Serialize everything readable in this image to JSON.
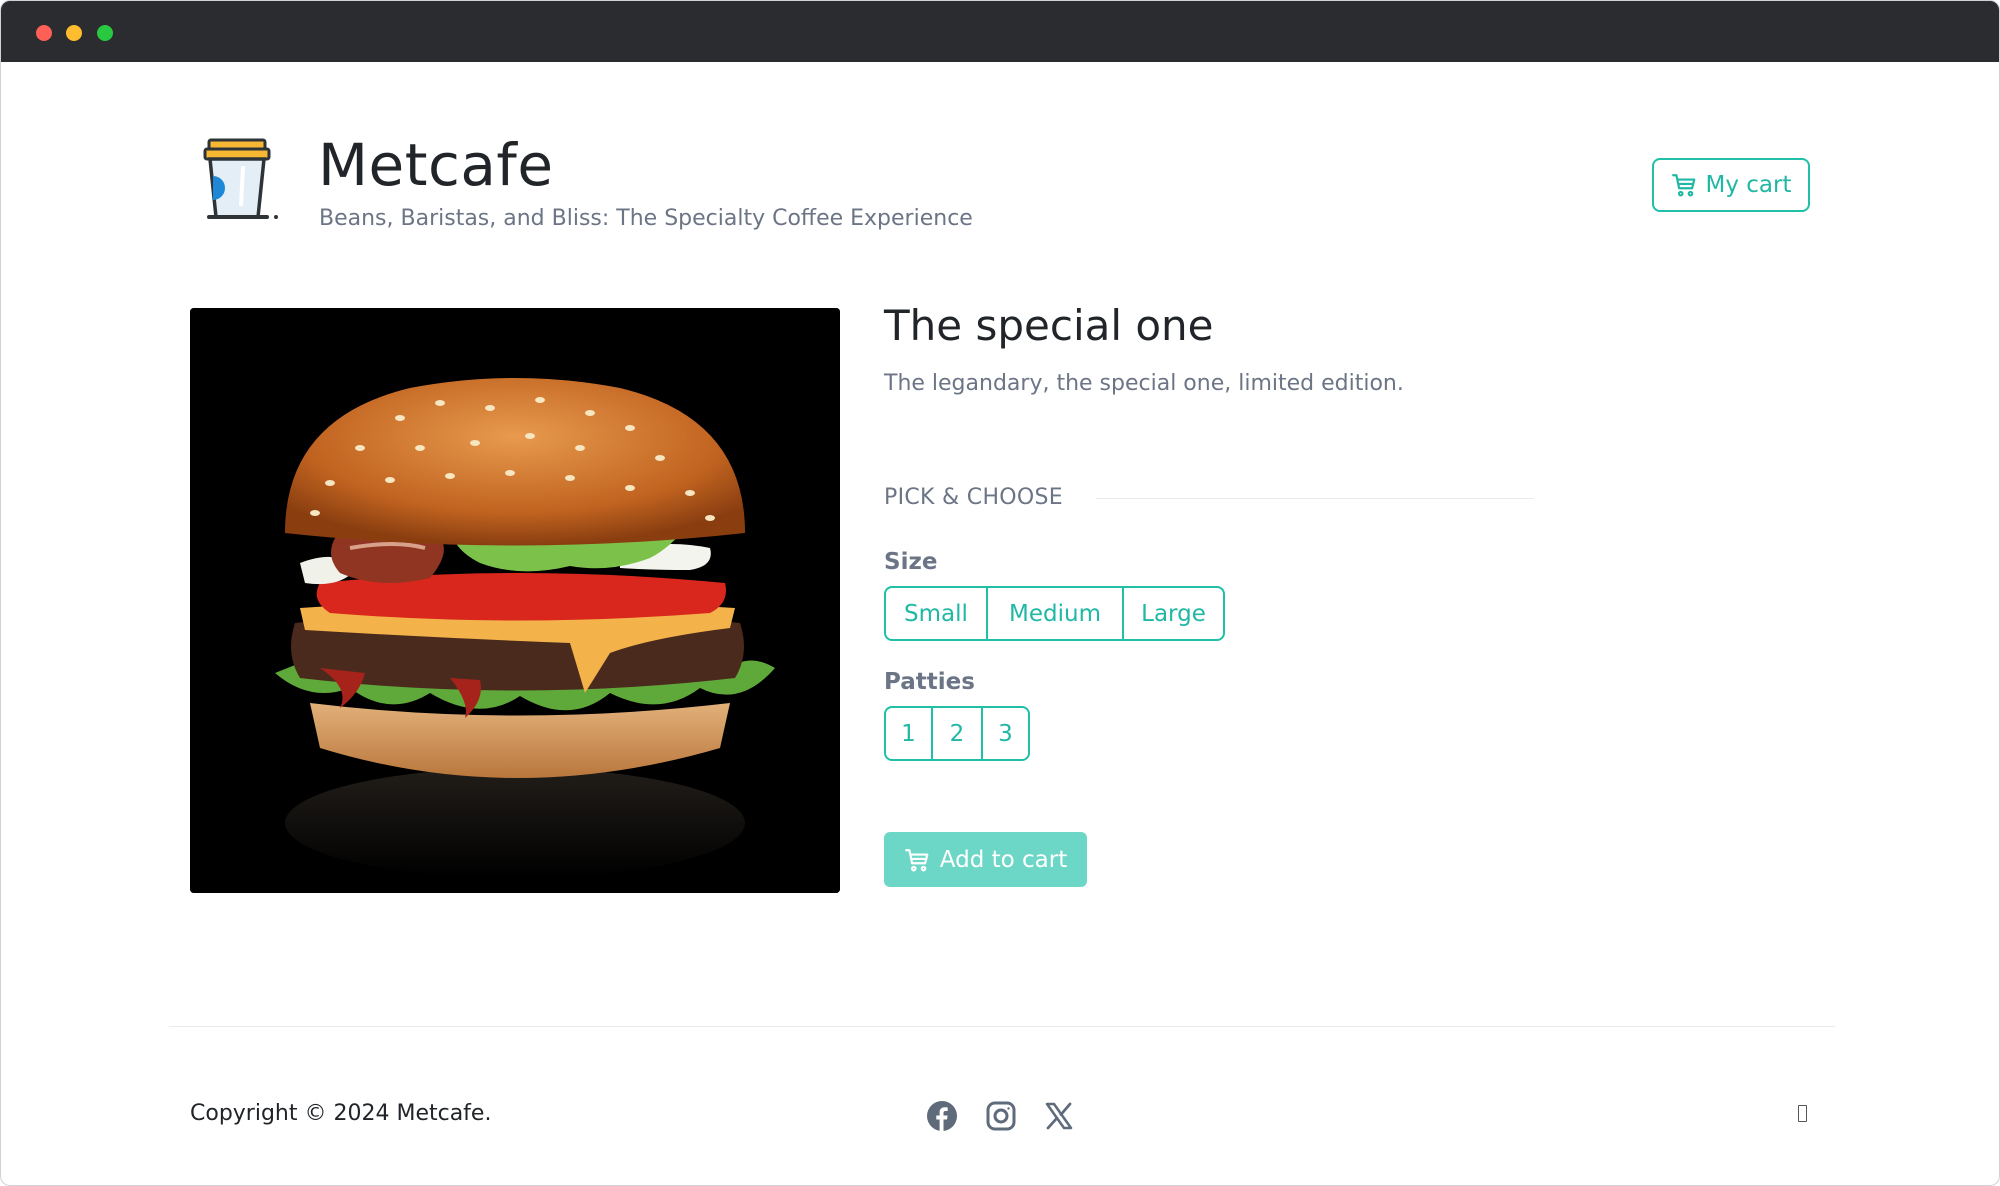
{
  "header": {
    "title": "Metcafe",
    "tagline": "Beans, Baristas, and Bliss: The Specialty Coffee Experience",
    "cart_label": "My cart"
  },
  "product": {
    "title": "The special one",
    "description": "The legandary, the special one, limited edition.",
    "image_alt": "burger"
  },
  "options": {
    "heading": "PICK & CHOOSE",
    "size": {
      "label": "Size",
      "choices": [
        "Small",
        "Medium",
        "Large"
      ]
    },
    "patties": {
      "label": "Patties",
      "choices": [
        "1",
        "2",
        "3"
      ]
    },
    "add_to_cart": "Add to cart"
  },
  "footer": {
    "copyright": "Copyright © 2024 Metcafe.",
    "social": [
      "facebook-icon",
      "instagram-icon",
      "x-icon"
    ]
  },
  "colors": {
    "accent": "#20c0a8",
    "add_button": "#6dd7c7",
    "titlebar": "#2b2c2f"
  }
}
